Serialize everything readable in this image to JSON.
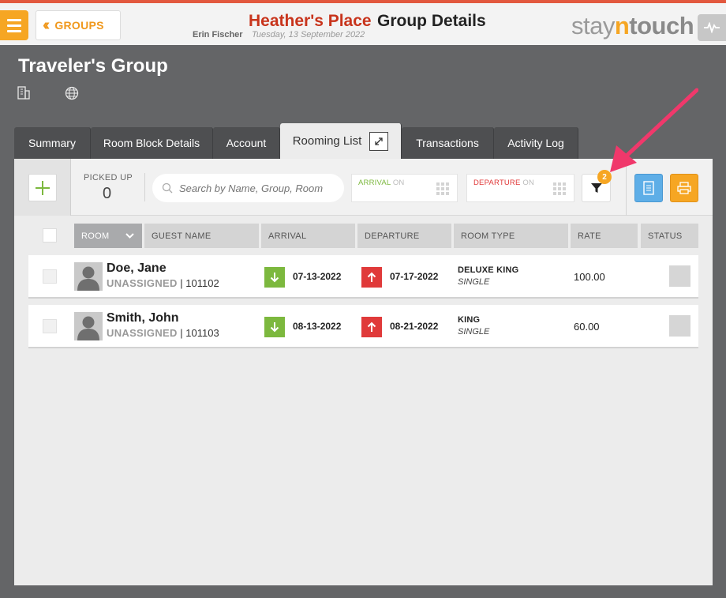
{
  "topbar": {
    "groups_label": "GROUPS",
    "hotel_name": "Heather's Place",
    "page_title": "Group Details",
    "user_name": "Erin Fischer",
    "business_date": "Tuesday, 13 September 2022",
    "logo": {
      "part1": "stay",
      "part2": "n",
      "part3": "touch"
    }
  },
  "group": {
    "title": "Traveler's Group",
    "icons": [
      "building-icon",
      "globe-icon"
    ]
  },
  "tabs": [
    {
      "label": "Summary",
      "active": false
    },
    {
      "label": "Room Block Details",
      "active": false
    },
    {
      "label": "Account",
      "active": false
    },
    {
      "label": "Rooming List",
      "active": true
    },
    {
      "label": "Transactions",
      "active": false
    },
    {
      "label": "Activity Log",
      "active": false
    }
  ],
  "toolbar": {
    "picked_up_label": "PICKED UP",
    "picked_up_value": "0",
    "search_placeholder": "Search by Name, Group, Room",
    "arrival_label": "ARRIVAL",
    "arrival_on": "ON",
    "departure_label": "DEPARTURE",
    "departure_on": "ON",
    "filter_count": "2"
  },
  "columns": [
    "ROOM",
    "GUEST NAME",
    "ARRIVAL",
    "DEPARTURE",
    "ROOM TYPE",
    "RATE",
    "STATUS"
  ],
  "rows": [
    {
      "guest": "Doe, Jane",
      "room_status": "UNASSIGNED",
      "confirmation": "101102",
      "arrival": "07-13-2022",
      "departure": "07-17-2022",
      "room_type": "DELUXE KING",
      "occupancy": "SINGLE",
      "rate": "100.00"
    },
    {
      "guest": "Smith, John",
      "room_status": "UNASSIGNED",
      "confirmation": "101103",
      "arrival": "08-13-2022",
      "departure": "08-21-2022",
      "room_type": "KING",
      "occupancy": "SINGLE",
      "rate": "60.00"
    }
  ],
  "colors": {
    "accent_orange": "#f6a623",
    "hotel_red": "#c8341c",
    "arrival_green": "#7cb83e",
    "departure_red": "#e03a3a",
    "annotation_pink": "#f0386b"
  }
}
